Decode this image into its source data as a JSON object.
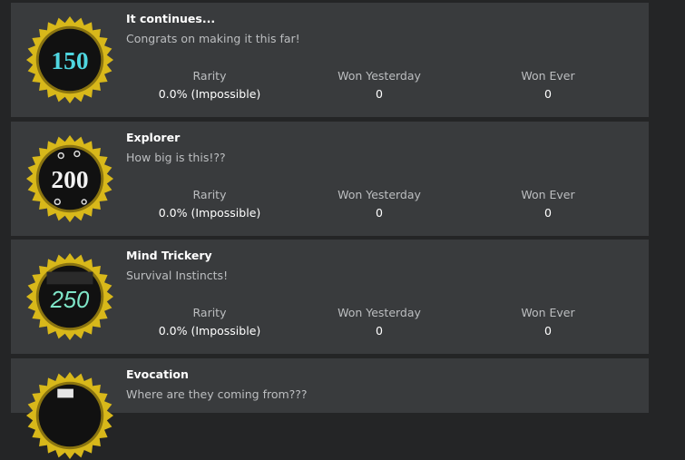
{
  "badges": [
    {
      "title": "It continues...",
      "description": "Congrats on making it this far!",
      "number_label": "150",
      "icon": "badge-150-icon",
      "stats": {
        "rarity_label": "Rarity",
        "rarity_value": "0.0% (Impossible)",
        "won_yesterday_label": "Won Yesterday",
        "won_yesterday_value": "0",
        "won_ever_label": "Won Ever",
        "won_ever_value": "0"
      }
    },
    {
      "title": "Explorer",
      "description": "How big is this!??",
      "number_label": "200",
      "icon": "badge-200-icon",
      "stats": {
        "rarity_label": "Rarity",
        "rarity_value": "0.0% (Impossible)",
        "won_yesterday_label": "Won Yesterday",
        "won_yesterday_value": "0",
        "won_ever_label": "Won Ever",
        "won_ever_value": "0"
      }
    },
    {
      "title": "Mind Trickery",
      "description": "Survival Instincts!",
      "number_label": "250",
      "icon": "badge-250-icon",
      "stats": {
        "rarity_label": "Rarity",
        "rarity_value": "0.0% (Impossible)",
        "won_yesterday_label": "Won Yesterday",
        "won_yesterday_value": "0",
        "won_ever_label": "Won Ever",
        "won_ever_value": "0"
      }
    },
    {
      "title": "Evocation",
      "description": "Where are they coming from???",
      "icon": "badge-evocation-icon"
    }
  ],
  "colors": {
    "page_background": "#242526",
    "card_background": "#393b3d",
    "badge_rim_gold": "#d8b81a",
    "badge_center": "#111111",
    "number_150": "#4fd6e0",
    "number_200": "#f2f2f2",
    "number_250": "#7fe6c8"
  }
}
